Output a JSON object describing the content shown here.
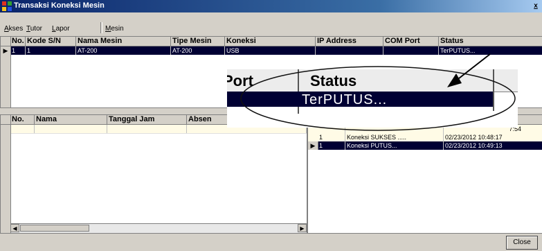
{
  "window": {
    "title": "Transaksi Koneksi Mesin",
    "close_glyph": "x"
  },
  "menu": [
    {
      "label": "Akses",
      "ul": "A"
    },
    {
      "label": "Tutor",
      "ul": "T"
    },
    {
      "label": "Lapor",
      "ul": "L"
    },
    {
      "label": "Mesin",
      "ul": "M"
    }
  ],
  "machines": {
    "columns": [
      "No.",
      "Kode S/N",
      "Nama Mesin",
      "Tipe Mesin",
      "Koneksi",
      "IP Address",
      "COM Port",
      "Status"
    ],
    "rows": [
      {
        "no": "1",
        "kode": "1",
        "nama": "AT-200",
        "tipe": "AT-200",
        "koneksi": "USB",
        "ip": "",
        "com": "",
        "status": "TerPUTUS..."
      }
    ]
  },
  "attendance": {
    "columns": [
      "No.",
      "Nama",
      "Tanggal Jam",
      "Absen"
    ]
  },
  "log": {
    "rows": [
      {
        "no": "",
        "text": "",
        "time": "7:54"
      },
      {
        "no": "1",
        "text": "Koneksi SUKSES .....",
        "time": "02/23/2012 10:48:17"
      },
      {
        "no": "1",
        "text": "Koneksi PUTUS...",
        "time": "02/23/2012 10:49:13"
      }
    ]
  },
  "zoom": {
    "port_text": "Port",
    "status_label": "Status",
    "status_value": "TerPUTUS..."
  },
  "close_button": {
    "label": "Close"
  }
}
